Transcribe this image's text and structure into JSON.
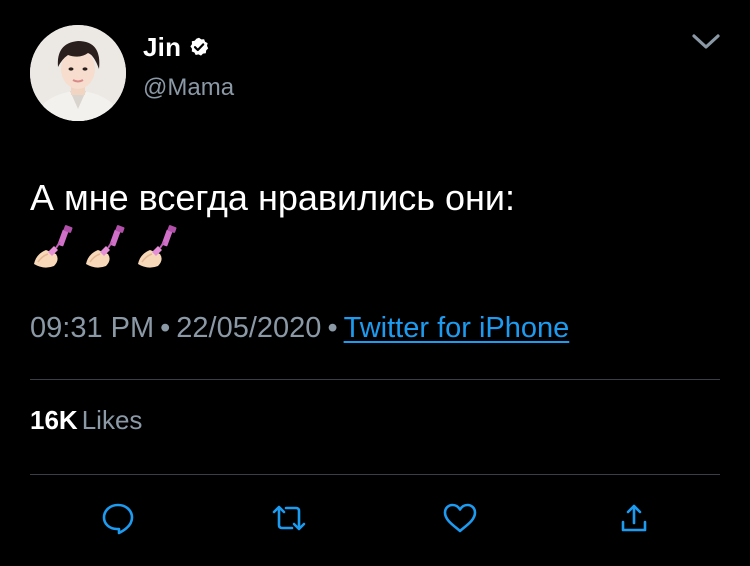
{
  "author": {
    "display_name": "Jin",
    "handle": "@Mama",
    "verified": true
  },
  "tweet": {
    "text": "А мне всегда нравились они:",
    "emojis": [
      "nail-polish-emoji",
      "nail-polish-emoji",
      "nail-polish-emoji"
    ],
    "time": "09:31 PM",
    "separator": "•",
    "date": "22/05/2020",
    "source": "Twitter for iPhone"
  },
  "stats": {
    "likes_count": "16K",
    "likes_label": "Likes"
  },
  "actions": [
    "reply-icon",
    "retweet-icon",
    "like-icon",
    "share-icon"
  ],
  "colors": {
    "background": "#000000",
    "text": "#ffffff",
    "secondary": "#8b98a5",
    "link": "#1d9bf0",
    "divider": "#3a3f45",
    "icon": "#1d9bf0"
  }
}
